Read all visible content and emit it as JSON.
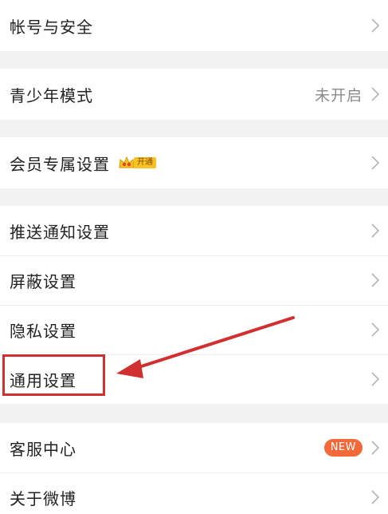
{
  "settings": {
    "account_security": "帐号与安全",
    "teen_mode": "青少年模式",
    "teen_mode_status": "未开启",
    "vip_settings": "会员专属设置",
    "vip_badge": "开通",
    "push_settings": "推送通知设置",
    "block_settings": "屏蔽设置",
    "privacy_settings": "隐私设置",
    "general_settings": "通用设置",
    "customer_service": "客服中心",
    "new_badge": "NEW",
    "about_weibo": "关于微博"
  },
  "colors": {
    "highlight": "#d0302f",
    "new_badge": "#f26a3a",
    "vip_badge": "#f7c321"
  },
  "icons": [
    "chevron-right-icon",
    "crown-icon",
    "arrow-annotation"
  ]
}
